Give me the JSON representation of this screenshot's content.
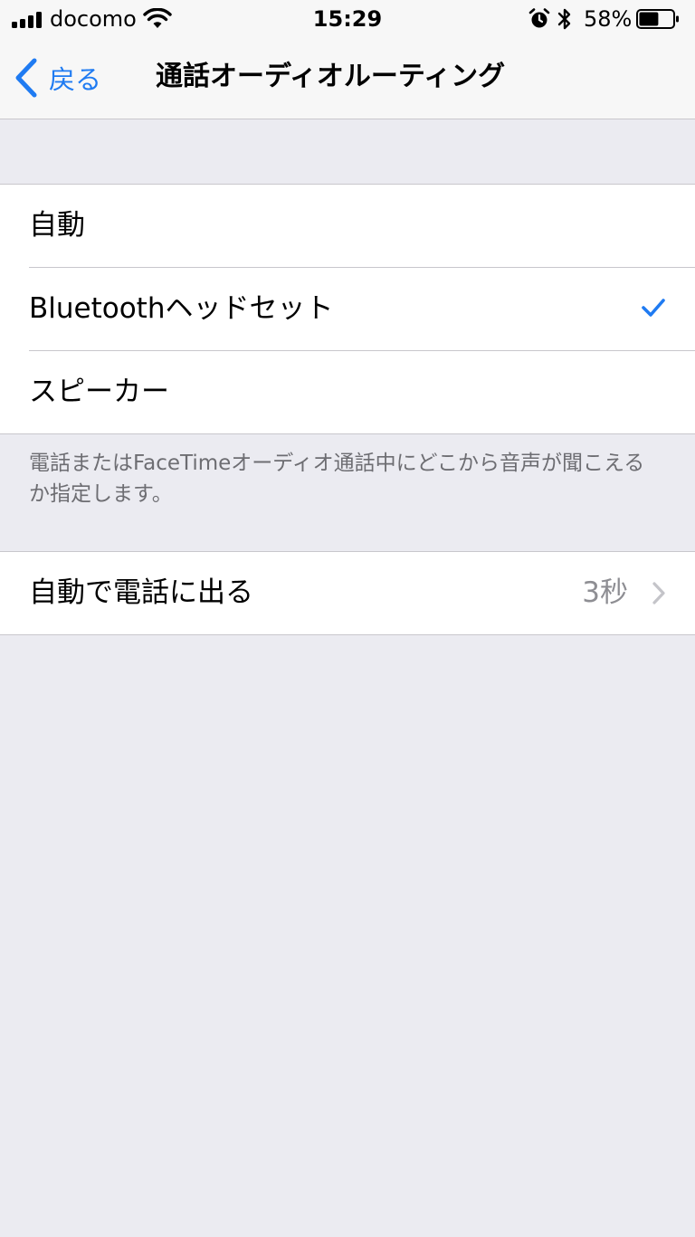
{
  "status_bar": {
    "carrier": "docomo",
    "time": "15:29",
    "battery_percent": "58%",
    "battery_level": 0.58,
    "signal_bars": 4,
    "icons": [
      "signal-icon",
      "wifi-icon",
      "alarm-icon",
      "bluetooth-icon",
      "battery-icon"
    ]
  },
  "nav": {
    "back_label": "戻る",
    "title": "通話オーディオルーティング"
  },
  "routing_options": [
    {
      "label": "自動",
      "selected": false
    },
    {
      "label": "Bluetoothヘッドセット",
      "selected": true
    },
    {
      "label": "スピーカー",
      "selected": false
    }
  ],
  "routing_footer": "電話またはFaceTimeオーディオ通話中にどこから音声が聞こえるか指定します。",
  "auto_answer": {
    "label": "自動で電話に出る",
    "value": "3秒"
  },
  "colors": {
    "accent": "#1f7bf2",
    "background": "#ebebf1",
    "separator": "#c8c7cc",
    "secondary_text": "#8e8e93"
  }
}
